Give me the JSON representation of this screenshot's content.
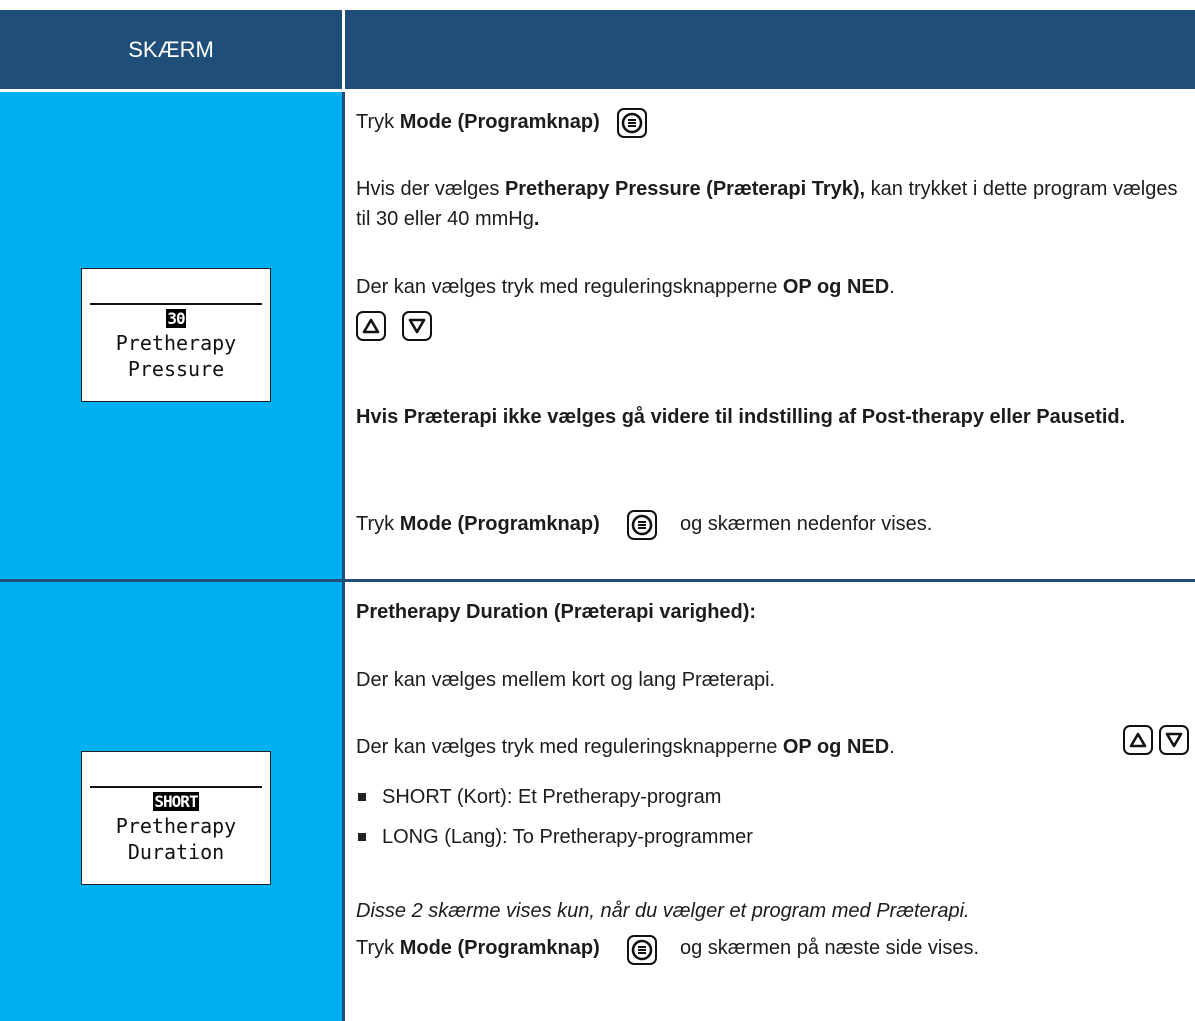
{
  "header": {
    "left_title": "SKÆRM"
  },
  "row1": {
    "lcd": {
      "value": "30",
      "line1": "Pretherapy",
      "line2": "Pressure"
    },
    "p1_pre": "Tryk ",
    "p1_bold": "Mode (Programknap)",
    "p2_pre": "Hvis der vælges ",
    "p2_bold": "Pretherapy Pressure (Præterapi Tryk),",
    "p2_post": " kan trykket i dette program vælges til 30 eller 40 mmHg",
    "p2_dot": ".",
    "p3_pre": "Der kan vælges tryk med reguleringsknapperne ",
    "p3_bold": "OP og NED",
    "p3_post": ".",
    "p4_bold": "Hvis Præterapi ikke vælges gå videre til indstilling af Post-therapy eller Pausetid.",
    "p5_pre": "Tryk ",
    "p5_bold": "Mode (Programknap)",
    "p5_post": "og skærmen nedenfor vises."
  },
  "row2": {
    "lcd": {
      "value": "SHORT",
      "line1": "Pretherapy",
      "line2": "Duration"
    },
    "p1_bold": "Pretherapy Duration (Præterapi varighed):",
    "p2": "Der kan vælges mellem kort og lang Præterapi.",
    "p3_pre": "Der kan vælges tryk med reguleringsknapperne ",
    "p3_bold": "OP og NED",
    "p3_post": ".",
    "bullets": [
      "SHORT (Kort): Et Pretherapy-program",
      "LONG (Lang): To Pretherapy-programmer"
    ],
    "p4_italic": "Disse 2 skærme vises kun, når du vælger et program med Præterapi.",
    "p5_pre": "Tryk ",
    "p5_bold": "Mode (Programknap)",
    "p5_post": "og skærmen på næste side vises."
  },
  "icons": {
    "mode": "mode-button-icon",
    "up": "up-arrow-icon",
    "down": "down-arrow-icon"
  }
}
